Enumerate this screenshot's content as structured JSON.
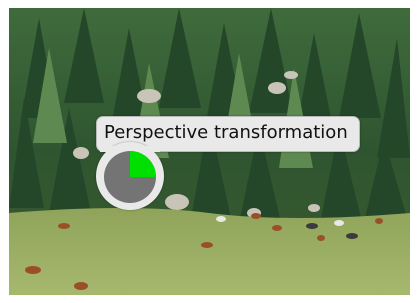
{
  "osd": {
    "label": "Perspective transformation",
    "progress_fraction": 0.25,
    "progress_color": "#00e000",
    "track_color": "#747474",
    "background_color": "#e9e9e9"
  }
}
